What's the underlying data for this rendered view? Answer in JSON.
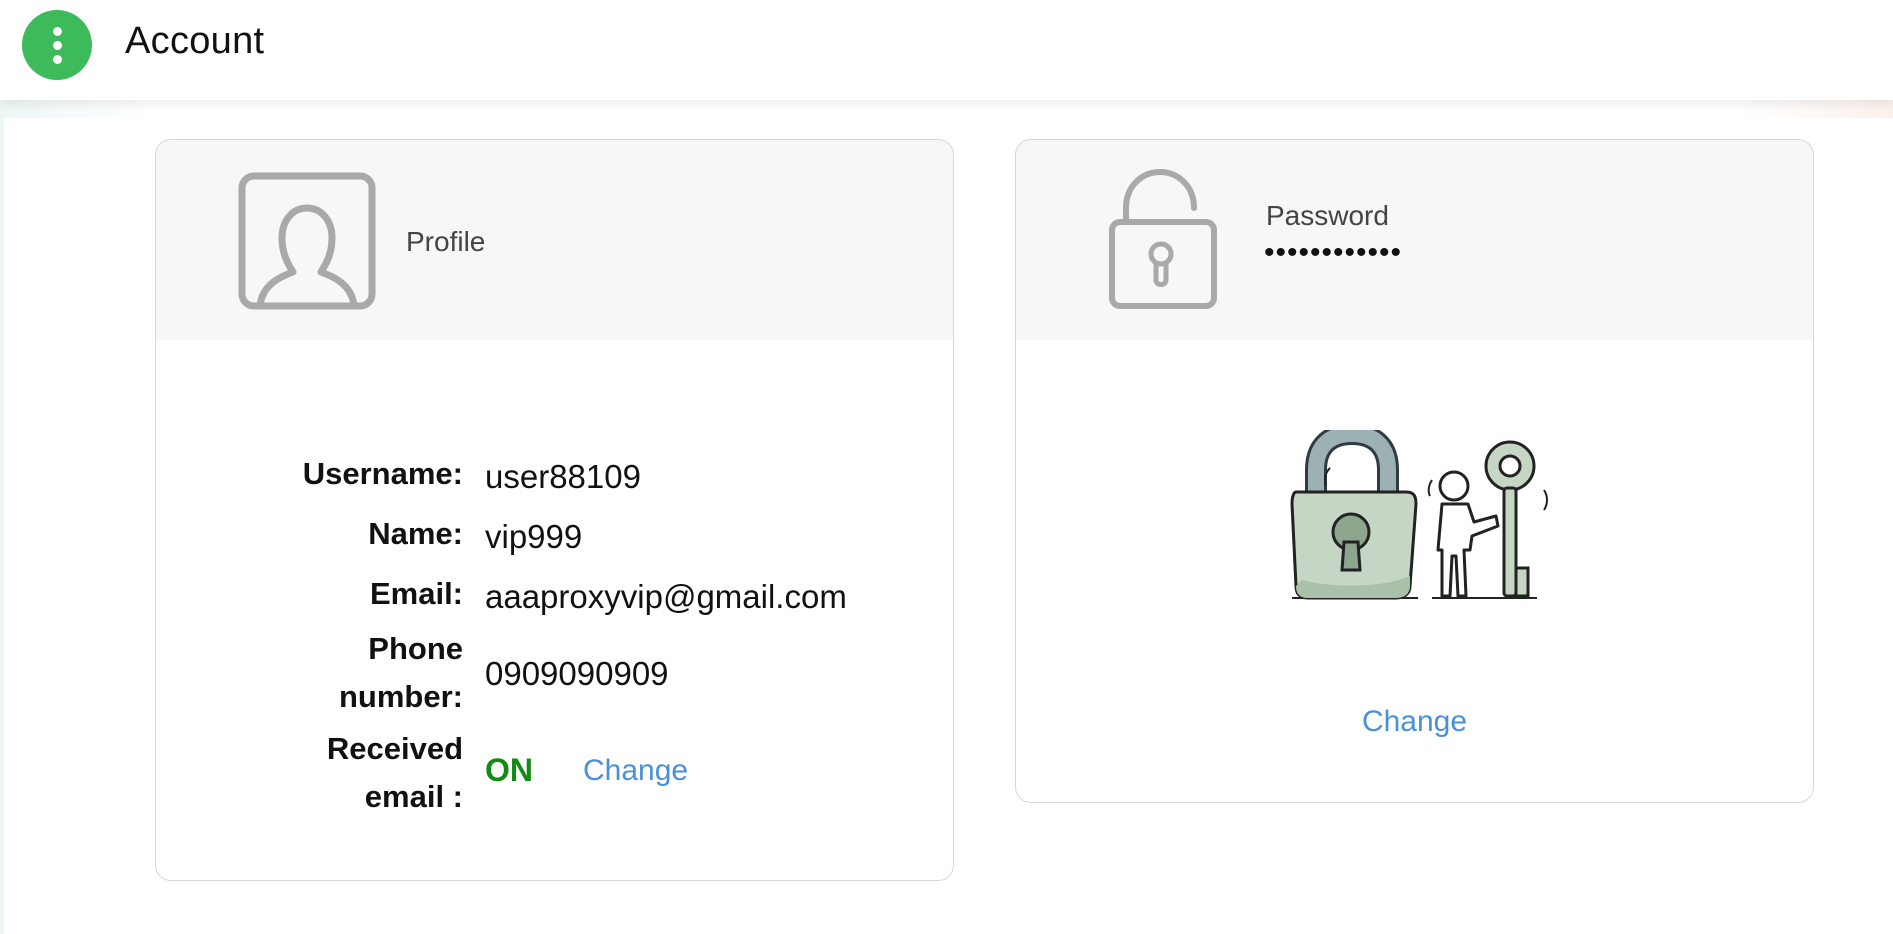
{
  "header": {
    "title": "Account",
    "menu_icon": "more-vertical-icon",
    "accent_color": "#3dba5a"
  },
  "profile_card": {
    "icon": "user-profile-icon",
    "title": "Profile",
    "fields": {
      "username_label": "Username:",
      "username_value": "user88109",
      "name_label": "Name:",
      "name_value": "vip999",
      "email_label": "Email:",
      "email_value": "aaaproxyvip@gmail.com",
      "phone_label_line1": "Phone",
      "phone_label_line2": "number:",
      "phone_value": "0909090909",
      "received_label_line1": "Received",
      "received_label_line2": "email :",
      "received_value": "ON",
      "received_change": "Change"
    },
    "status_color": "#138a13",
    "link_color": "#4a90d9"
  },
  "password_card": {
    "icon": "padlock-icon",
    "title": "Password",
    "masked_value": "••••••••••••",
    "illustration": "lock-and-key-illustration",
    "change_label": "Change"
  }
}
